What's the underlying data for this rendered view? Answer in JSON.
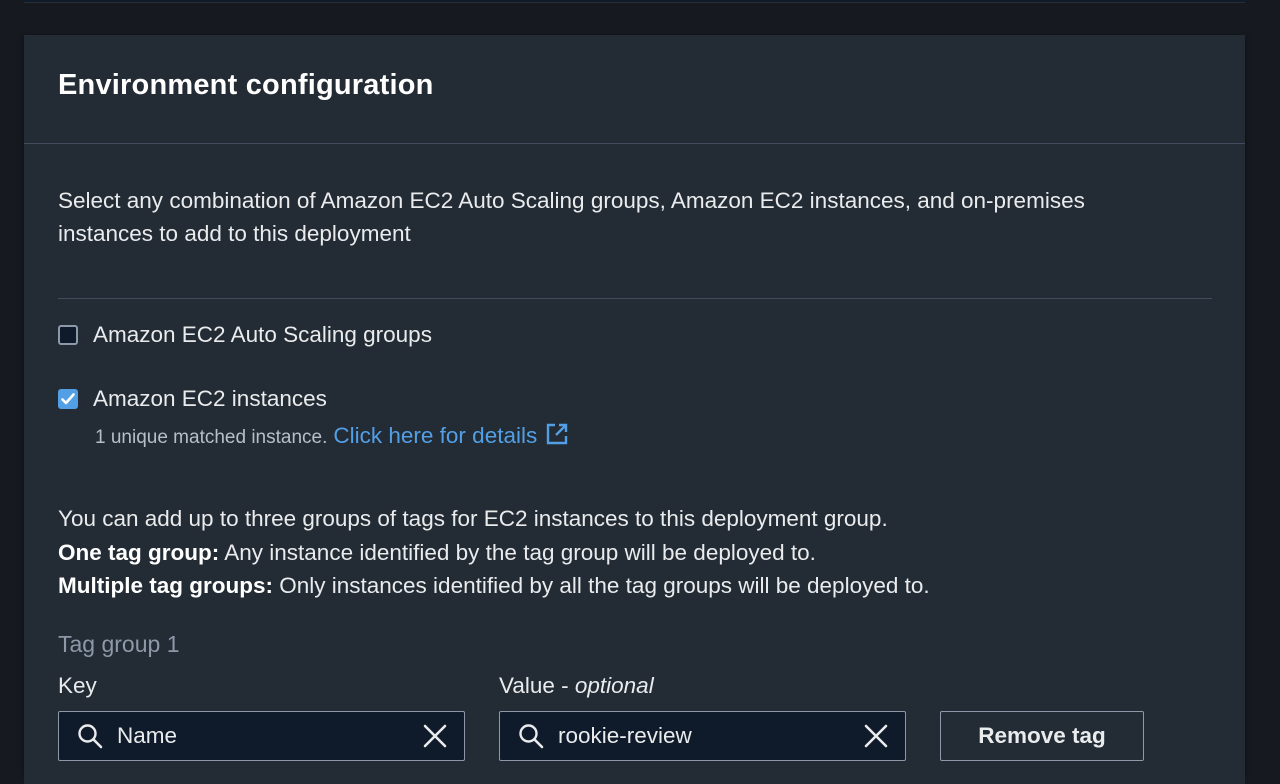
{
  "card": {
    "title": "Environment configuration",
    "description": "Select any combination of Amazon EC2 Auto Scaling groups, Amazon EC2 instances, and on-premises instances to add to this deployment"
  },
  "options": {
    "asg": {
      "label": "Amazon EC2 Auto Scaling groups",
      "checked": false
    },
    "ec2": {
      "label": "Amazon EC2 instances",
      "checked": true
    }
  },
  "matched": {
    "text": "1 unique matched instance.",
    "link": "Click here for details"
  },
  "info": {
    "line1": "You can add up to three groups of tags for EC2 instances to this deployment group.",
    "line2_bold": "One tag group:",
    "line2_rest": " Any instance identified by the tag group will be deployed to.",
    "line3_bold": "Multiple tag groups:",
    "line3_rest": " Only instances identified by all the tag groups will be deployed to."
  },
  "tag_group": {
    "title": "Tag group 1",
    "key_label": "Key",
    "value_label": "Value - ",
    "value_label_optional": "optional",
    "key_value": "Name",
    "value_value": "rookie-review",
    "remove_label": "Remove tag"
  },
  "icons": {
    "search": "search-icon",
    "clear": "close-icon",
    "external": "external-link-icon",
    "check": "checkmark-icon"
  },
  "colors": {
    "accent": "#539fe5",
    "background": "#16191f",
    "card": "#232b34"
  }
}
